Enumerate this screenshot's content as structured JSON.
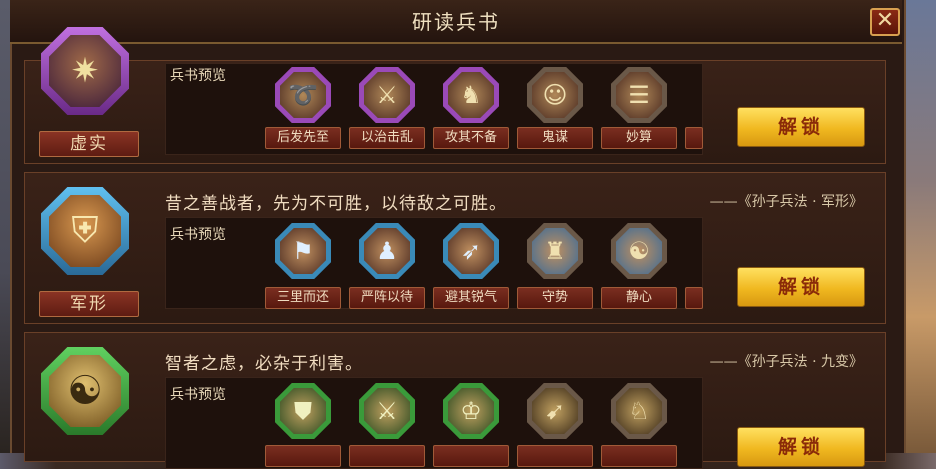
{
  "window": {
    "title": "研读兵书",
    "close_glyph": "✕"
  },
  "colors": {
    "purple_frame": "#9a4ab8",
    "blue_frame": "#3a8ab8",
    "green_frame": "#3a9a3a",
    "unlock_gold": "#f0b820",
    "label_red": "#7a2e20"
  },
  "sections": [
    {
      "book_name": "虚实",
      "book_icon": "lightning-burst-icon",
      "quote": "",
      "source": "",
      "preview_label": "兵书预览",
      "skills": [
        "后发先至",
        "以治击乱",
        "攻其不备",
        "鬼谋",
        "妙算"
      ],
      "skill_icons": [
        "arrow-swirl-icon",
        "warrior-icon",
        "charging-soldier-icon",
        "strategist-icon",
        "scroll-icon"
      ],
      "unlock_label": "解锁"
    },
    {
      "book_name": "军形",
      "book_icon": "shield-spears-icon",
      "quote": "昔之善战者，先为不可胜，以待敌之可胜。",
      "source": "——《孙子兵法 · 军形》",
      "preview_label": "兵书预览",
      "skills": [
        "三里而还",
        "严阵以待",
        "避其锐气",
        "守势",
        "静心"
      ],
      "skill_icons": [
        "banner-soldier-icon",
        "formation-icon",
        "dodging-soldier-icon",
        "fortress-icon",
        "meditation-icon"
      ],
      "unlock_label": "解锁"
    },
    {
      "book_name": "",
      "book_icon": "yin-yang-icon",
      "quote": "智者之虑，必杂于利害。",
      "source": "——《孙子兵法 · 九变》",
      "preview_label": "兵书预览",
      "skills": [
        "",
        "",
        "",
        "",
        ""
      ],
      "skill_icons": [
        "shield-soldier-icon",
        "sword-raise-icon",
        "helmet-general-icon",
        "archer-icon",
        "cavalry-icon"
      ],
      "unlock_label": "解锁"
    }
  ]
}
